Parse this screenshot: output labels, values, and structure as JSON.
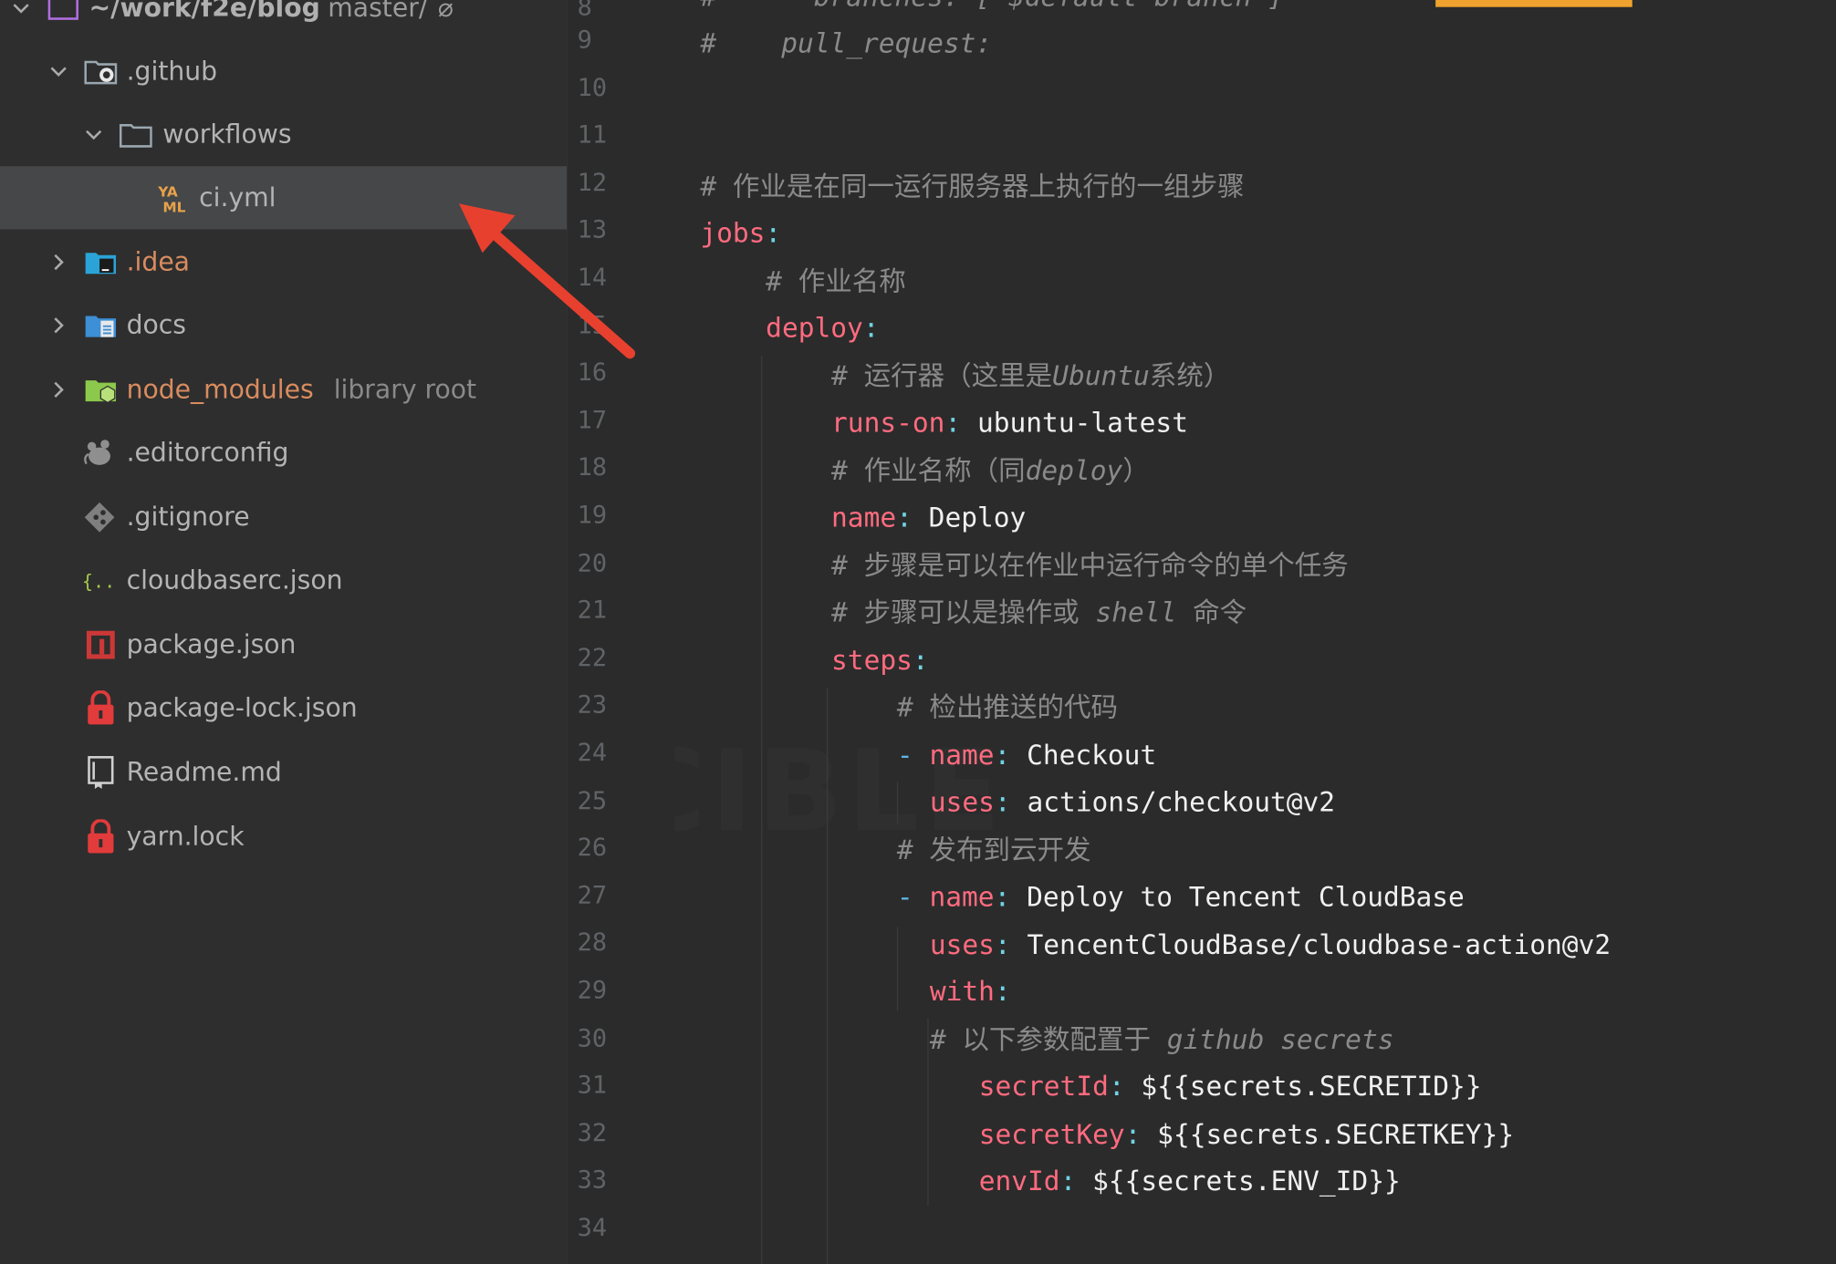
{
  "project": {
    "root_path": "~/work/f2e/blog",
    "branch": "master/",
    "branch_icon": "no-entry-symbol"
  },
  "tree": [
    {
      "label": ".github",
      "icon": "folder-github-icon",
      "expanded": true
    },
    {
      "label": "workflows",
      "icon": "folder-icon",
      "expanded": true
    },
    {
      "label": "ci.yml",
      "icon": "yaml-file-icon",
      "selected": true
    },
    {
      "label": ".idea",
      "icon": "folder-idea-icon",
      "expanded": false
    },
    {
      "label": "docs",
      "icon": "folder-docs-icon",
      "expanded": false
    },
    {
      "label": "node_modules",
      "suffix": "library root",
      "icon": "folder-node-icon",
      "expanded": false
    },
    {
      "label": ".editorconfig",
      "icon": "editorconfig-icon"
    },
    {
      "label": ".gitignore",
      "icon": "git-icon"
    },
    {
      "label": "cloudbaserc.json",
      "icon": "json-file-icon"
    },
    {
      "label": "package.json",
      "icon": "npm-icon"
    },
    {
      "label": "package-lock.json",
      "icon": "lock-icon"
    },
    {
      "label": "Readme.md",
      "icon": "markdown-file-icon"
    },
    {
      "label": "yarn.lock",
      "icon": "lock-icon"
    }
  ],
  "editor": {
    "line_numbers": [
      "9",
      "10",
      "11",
      "12",
      "13",
      "14",
      "15",
      "16",
      "17",
      "18",
      "19",
      "20",
      "21",
      "22",
      "23",
      "24",
      "25",
      "26",
      "27",
      "28",
      "29",
      "30",
      "31",
      "32",
      "33",
      "34"
    ],
    "line8_partial": "#      branches: [ $default-branch ]",
    "lines": {
      "l9": {
        "hash": "#",
        "text": "pull_request:"
      },
      "l12": {
        "text": "# 作业是在同一运行服务器上执行的一组步骤"
      },
      "l13": {
        "key": "jobs",
        "colon": ":"
      },
      "l14": {
        "text": "# 作业名称"
      },
      "l15": {
        "key": "deploy",
        "colon": ":"
      },
      "l16": {
        "a": "# 运行器（这里是",
        "b": "Ubuntu",
        "c": "系统）"
      },
      "l17": {
        "key": "runs-on",
        "colon": ":",
        "value": " ubuntu-latest"
      },
      "l18": {
        "a": "# 作业名称（同",
        "b": "deploy",
        "c": "）"
      },
      "l19": {
        "key": "name",
        "colon": ":",
        "value": " Deploy"
      },
      "l20": {
        "text": "# 步骤是可以在作业中运行命令的单个任务"
      },
      "l21": {
        "a": "# 步骤可以是操作或 ",
        "b": "shell",
        "c": " 命令"
      },
      "l22": {
        "key": "steps",
        "colon": ":"
      },
      "l23": {
        "text": "# 检出推送的代码"
      },
      "l24": {
        "dash": "- ",
        "key": "name",
        "colon": ":",
        "value": " Checkout"
      },
      "l25": {
        "key": "uses",
        "colon": ":",
        "value": " actions/checkout@v2"
      },
      "l26": {
        "text": "# 发布到云开发"
      },
      "l27": {
        "dash": "- ",
        "key": "name",
        "colon": ":",
        "value": " Deploy to Tencent CloudBase"
      },
      "l28": {
        "key": "uses",
        "colon": ":",
        "value": " TencentCloudBase/cloudbase-action@v2"
      },
      "l29": {
        "key": "with",
        "colon": ":"
      },
      "l30": {
        "a": "# 以下参数配置于 ",
        "b": "github secrets"
      },
      "l31": {
        "key": "secretId",
        "colon": ":",
        "value": " ${{secrets.SECRETID}}"
      },
      "l32": {
        "key": "secretKey",
        "colon": ":",
        "value": " ${{secrets.SECRETKEY}}"
      },
      "l33": {
        "key": "envId",
        "colon": ":",
        "value": " ${{secrets.ENV_ID}}"
      }
    }
  },
  "watermark": "INVINCIBLE",
  "colors": {
    "annotation_arrow": "#e8402e",
    "accent_bar": "#f0a22e"
  }
}
